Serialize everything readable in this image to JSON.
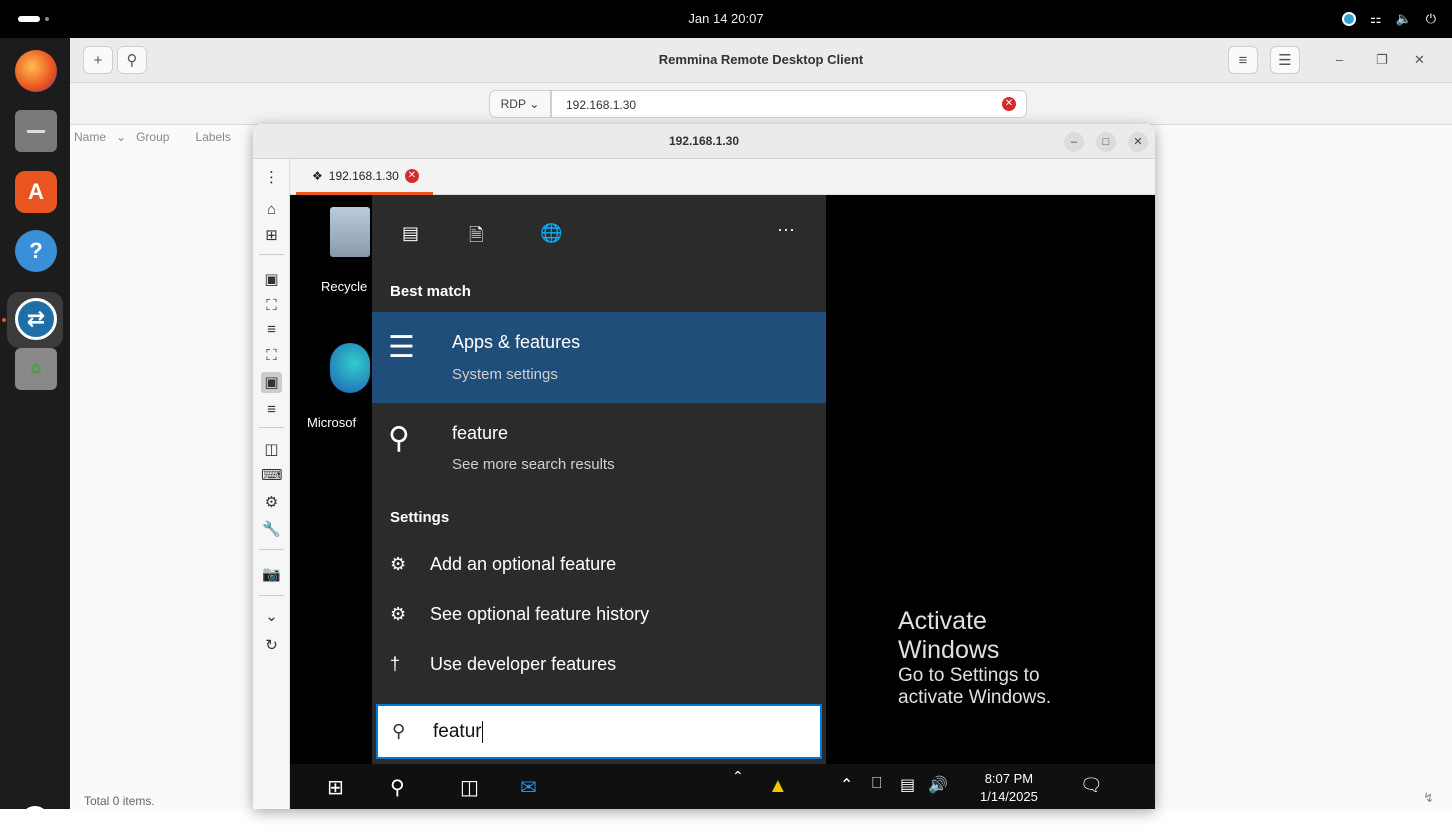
{
  "topbar": {
    "clock": "Jan 14  20:07"
  },
  "remmina": {
    "title": "Remmina Remote Desktop Client",
    "add_label": "+",
    "protocol": "RDP",
    "address": "192.168.1.30",
    "columns": [
      "Name",
      "Group",
      "Labels"
    ],
    "status": "Total 0 items."
  },
  "session": {
    "window_title": "192.168.1.30",
    "tab_label": "192.168.1.30"
  },
  "desktop": {
    "icons": [
      {
        "label": "Recycle"
      },
      {
        "label": "Microsof"
      }
    ]
  },
  "startmenu": {
    "best_match_header": "Best match",
    "best": {
      "name": "Apps & features",
      "sub": "System settings"
    },
    "web": {
      "name": "feature",
      "sub": "See more search results"
    },
    "settings_header": "Settings",
    "settings_items": [
      {
        "label": "Add an optional feature",
        "icon": "gear-icon"
      },
      {
        "label": "See optional feature history",
        "icon": "gear-icon"
      },
      {
        "label": "Use developer features",
        "icon": "developer-icon"
      }
    ],
    "more": "···",
    "search_text": "featur"
  },
  "activate": {
    "line1": "Activate",
    "line2": "Windows",
    "line3": "Go to Settings to",
    "line4": "activate Windows."
  },
  "taskbar": {
    "time": "8:07 PM",
    "date": "1/14/2025"
  },
  "colors": {
    "ubuntu_orange": "#e95420",
    "win_blue": "#1f4e7a",
    "accent_blue": "#0078d4"
  }
}
